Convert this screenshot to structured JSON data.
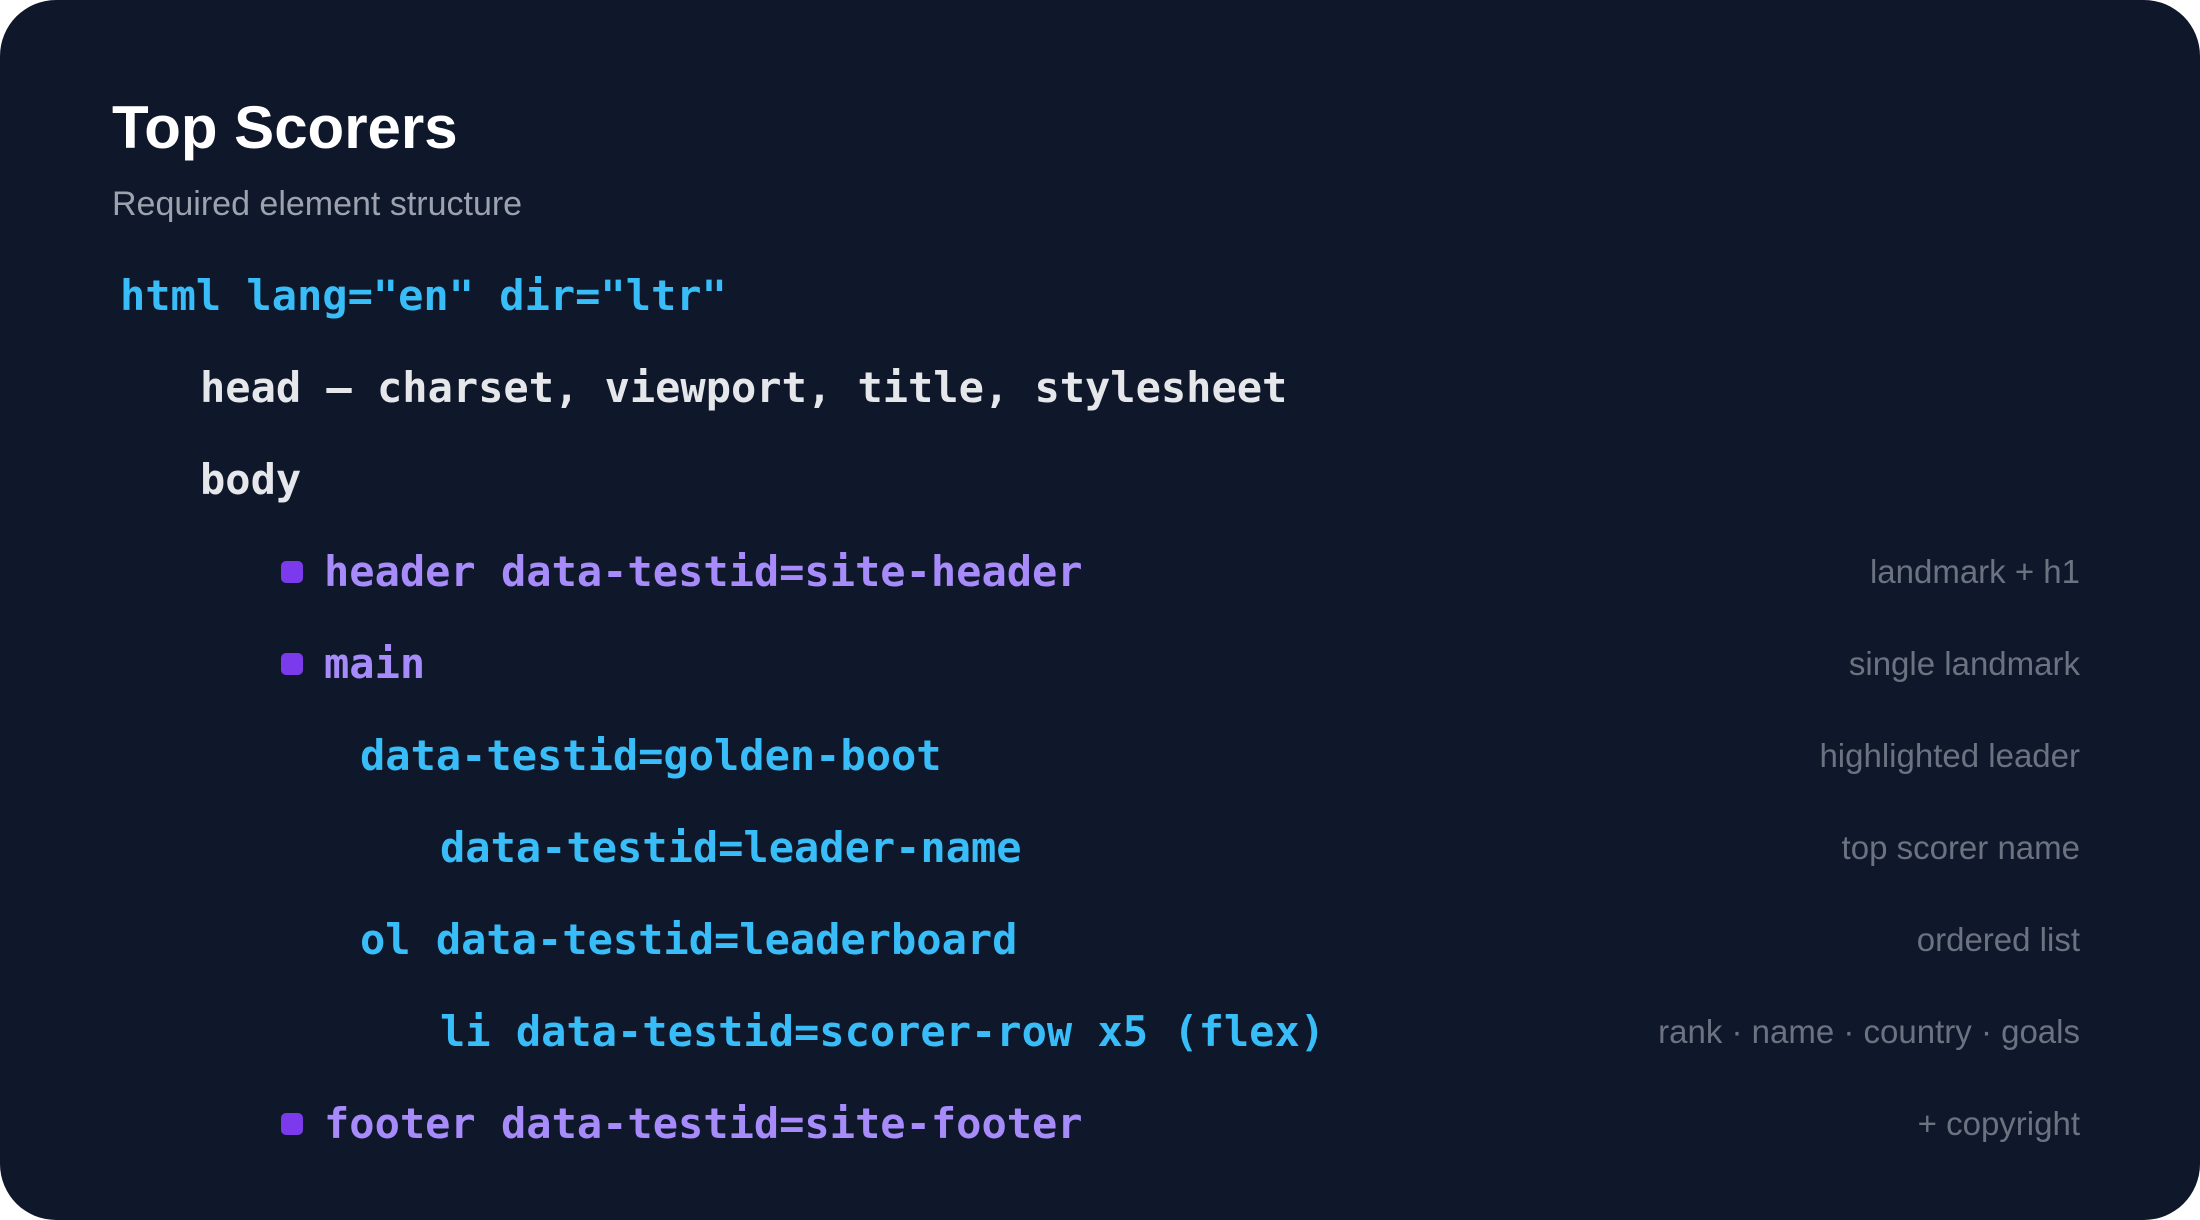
{
  "title": "Top Scorers",
  "subtitle": "Required element structure",
  "tree": {
    "html": {
      "code": "html lang=\"en\" dir=\"ltr\""
    },
    "head": {
      "code": "head — charset, viewport, title, stylesheet"
    },
    "body": {
      "code": "body"
    },
    "header": {
      "code": "header data-testid=site-header",
      "note": "landmark + h1"
    },
    "main": {
      "code": "main",
      "note": "single landmark"
    },
    "golden_boot": {
      "code": "data-testid=golden-boot",
      "note": "highlighted leader"
    },
    "leader_name": {
      "code": "data-testid=leader-name",
      "note": "top scorer name"
    },
    "leaderboard": {
      "code": "ol data-testid=leaderboard",
      "note": "ordered list"
    },
    "scorer_row": {
      "code": "li data-testid=scorer-row x5 (flex)",
      "note": "rank · name · country · goals"
    },
    "footer": {
      "code": "footer data-testid=site-footer",
      "note": "+ copyright"
    }
  },
  "colors": {
    "background": "#0f172a",
    "element_blue": "#38bdf8",
    "element_white": "#e5e7eb",
    "landmark_purple": "#a78bfa",
    "bullet_purple": "#7c3aed",
    "note_gray": "#6b7280"
  }
}
